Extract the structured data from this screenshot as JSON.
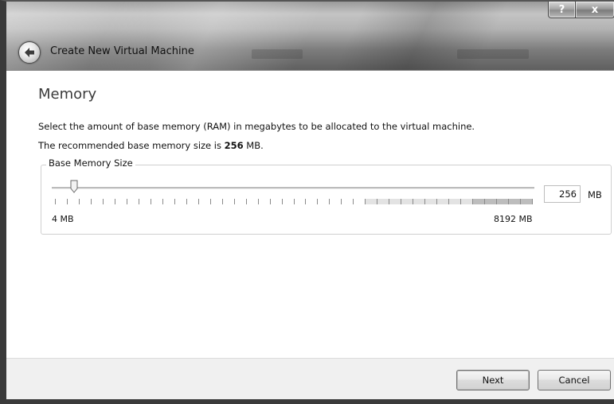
{
  "window": {
    "title": "Create New Virtual Machine",
    "help_label": "?",
    "close_label": "x"
  },
  "page": {
    "heading": "Memory",
    "description_line1": "Select the amount of base memory (RAM) in megabytes to be allocated to the virtual machine.",
    "description_line2_prefix": "The recommended base memory size is ",
    "recommended_value": "256",
    "description_line2_suffix": " MB."
  },
  "memory": {
    "group_title": "Base Memory Size",
    "value": "256",
    "unit": "MB",
    "min_label": "4 MB",
    "max_label": "8192 MB",
    "min_value": 4,
    "max_value": 8192,
    "current_value": 256
  },
  "footer": {
    "next_label": "Next",
    "cancel_label": "Cancel"
  },
  "colors": {
    "accent": "#707070",
    "warn_zone": "#e3e3e3",
    "danger_zone": "#bdbdbd"
  }
}
